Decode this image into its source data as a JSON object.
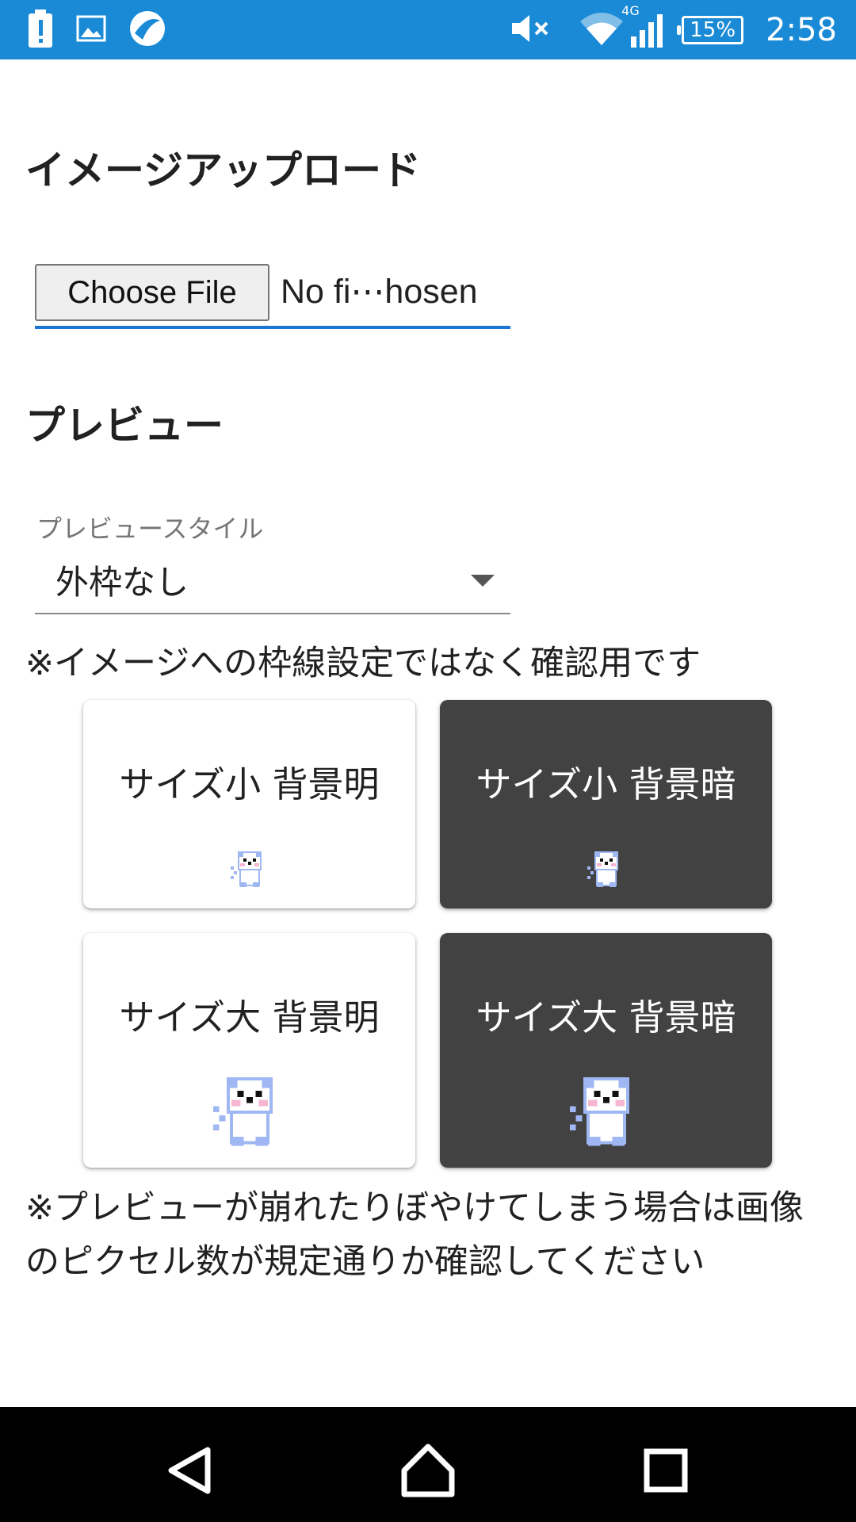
{
  "status_bar": {
    "time": "2:58",
    "battery_percent": "15%",
    "network_type": "4G",
    "icons_left": [
      "battery-alert-icon",
      "gallery-icon",
      "app-swirl-icon"
    ],
    "icons_right": [
      "volume-muted-icon",
      "wifi-icon",
      "cell-signal-icon",
      "battery-icon"
    ]
  },
  "upload": {
    "heading": "イメージアップロード",
    "choose_file_label": "Choose File",
    "file_status": "No fi⋯hosen"
  },
  "preview": {
    "heading": "プレビュー",
    "style_label": "プレビュースタイル",
    "style_value": "外枠なし",
    "note": "※イメージへの枠線設定ではなく確認用です",
    "cards": [
      {
        "label": "サイズ小 背景明",
        "theme": "light",
        "size": "small"
      },
      {
        "label": "サイズ小 背景暗",
        "theme": "dark",
        "size": "small"
      },
      {
        "label": "サイズ大 背景明",
        "theme": "light",
        "size": "large"
      },
      {
        "label": "サイズ大 背景暗",
        "theme": "dark",
        "size": "large"
      }
    ],
    "blur_note": "※プレビューが崩れたりぼやけてしまう場合は画像のピクセル数が規定通りか確認してください"
  },
  "colors": {
    "status_bar": "#1a8ad6",
    "focus_underline": "#1976d2",
    "card_dark": "#424242",
    "bear_outline": "#9fb7f2",
    "bear_cheek": "#f6b6d2"
  },
  "navigation": [
    "back-icon",
    "home-icon",
    "recents-icon"
  ]
}
